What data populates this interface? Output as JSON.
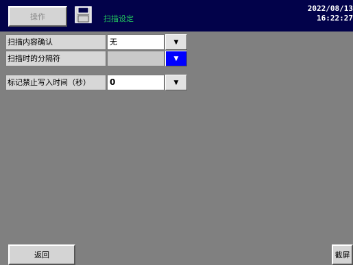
{
  "header": {
    "operate_label": "操作",
    "screen_title": "扫描设定",
    "date": "2022/08/13",
    "time": "16:22:27"
  },
  "settings": [
    {
      "label": "扫描内容确认",
      "value": "无",
      "dropdown_icon": "▼"
    },
    {
      "label": "扫描时的分隔符",
      "value": "",
      "dropdown_icon": "▼"
    },
    {
      "label": "标记禁止写入时间（秒）",
      "value": "0",
      "dropdown_icon": "▼"
    }
  ],
  "footer": {
    "back_label": "返回",
    "screenshot_label": "截屏"
  },
  "colors": {
    "background": "#808080",
    "header_bg": "#02024a",
    "title_text": "#22c55e",
    "active_dropdown": "#0000ff"
  },
  "icons": {
    "save": "save-icon",
    "dropdown": "chevron-down-icon"
  }
}
